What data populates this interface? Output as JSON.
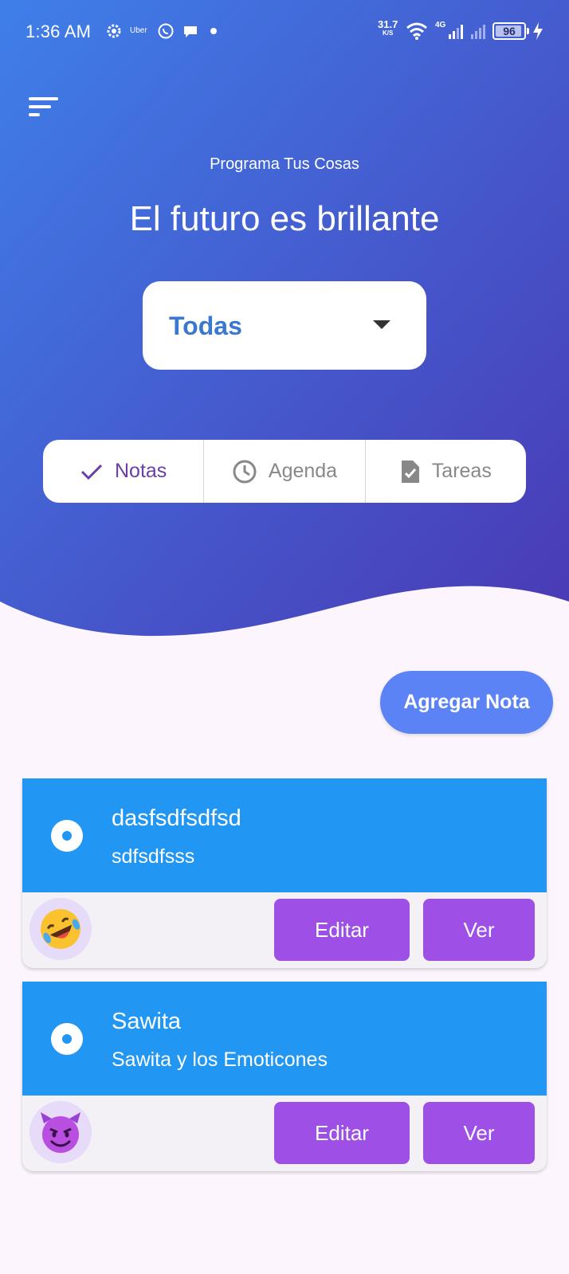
{
  "status_bar": {
    "time": "1:36 AM",
    "uber_label": "Uber",
    "net_speed": "31.7",
    "net_speed_unit": "K/S",
    "network_type": "4G",
    "battery": "96",
    "battery_level": 0.96
  },
  "header": {
    "subtitle": "Programa Tus Cosas",
    "title": "El futuro es brillante"
  },
  "filter": {
    "selected": "Todas"
  },
  "tabs": [
    {
      "label": "Notas",
      "icon": "check-icon",
      "active": true
    },
    {
      "label": "Agenda",
      "icon": "clock-icon",
      "active": false
    },
    {
      "label": "Tareas",
      "icon": "task-file-icon",
      "active": false
    }
  ],
  "add_button": {
    "label": "Agregar Nota"
  },
  "notes": [
    {
      "title": "dasfsdfsdfsd",
      "description": "sdfsdfsss",
      "emoji": "rofl-emoji",
      "edit_label": "Editar",
      "view_label": "Ver"
    },
    {
      "title": "Sawita",
      "description": "Sawita y los Emoticones",
      "emoji": "smiling-devil-emoji",
      "edit_label": "Editar",
      "view_label": "Ver"
    }
  ],
  "colors": {
    "gradient_start": "#3d78e6",
    "gradient_end": "#4a3bb8",
    "card_header": "#2196f3",
    "button": "#9e4fe6",
    "add_button": "#5b83f5",
    "accent": "#6a3ea7"
  }
}
